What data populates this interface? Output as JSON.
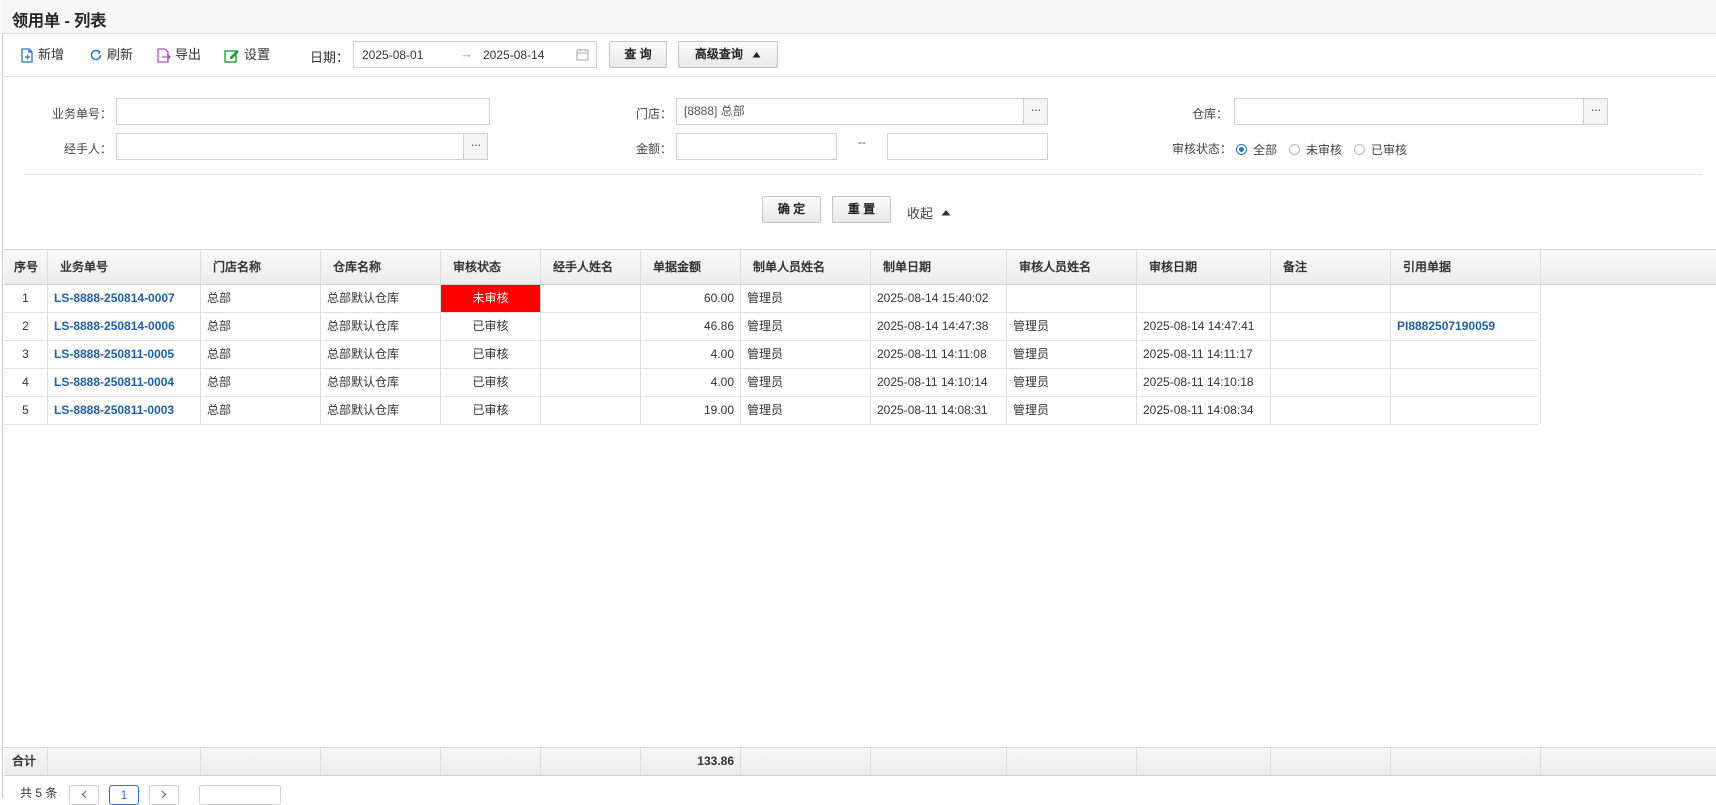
{
  "window": {
    "title": "领用单 - 列表"
  },
  "toolbar": {
    "add": "新增",
    "refresh": "刷新",
    "export": "导出",
    "settings": "设置",
    "date_label": "日期：",
    "date_from": "2025-08-01",
    "date_arrow": "→",
    "date_to": "2025-08-14",
    "query": "查 询",
    "advanced_query": "高级查询"
  },
  "filters": {
    "doc_no_label": "业务单号：",
    "doc_no_value": "",
    "store_label": "门店：",
    "store_value": "[8888] 总部",
    "warehouse_label": "仓库：",
    "warehouse_value": "",
    "handler_label": "经手人：",
    "handler_value": "",
    "amount_label": "金额：",
    "amount_from": "",
    "amount_sep": "--",
    "amount_to": "",
    "status_label": "审核状态：",
    "status_options": [
      "全部",
      "未审核",
      "已审核"
    ],
    "status_selected": "全部",
    "ok": "确 定",
    "reset": "重 置",
    "collapse": "收起",
    "more_glyph": "···"
  },
  "table": {
    "columns": [
      "序号",
      "业务单号",
      "门店名称",
      "仓库名称",
      "审核状态",
      "经手人姓名",
      "单据金额",
      "制单人员姓名",
      "制单日期",
      "审核人员姓名",
      "审核日期",
      "备注",
      "引用单据"
    ],
    "rows": [
      {
        "idx": "1",
        "doc_no": "LS-8888-250814-0007",
        "store": "总部",
        "warehouse": "总部默认仓库",
        "status": "未审核",
        "handler": "",
        "amount": "60.00",
        "creator": "管理员",
        "created": "2025-08-14 15:40:02",
        "reviewer": "",
        "reviewed": "",
        "remark": "",
        "ref": ""
      },
      {
        "idx": "2",
        "doc_no": "LS-8888-250814-0006",
        "store": "总部",
        "warehouse": "总部默认仓库",
        "status": "已审核",
        "handler": "",
        "amount": "46.86",
        "creator": "管理员",
        "created": "2025-08-14 14:47:38",
        "reviewer": "管理员",
        "reviewed": "2025-08-14 14:47:41",
        "remark": "",
        "ref": "PI8882507190059"
      },
      {
        "idx": "3",
        "doc_no": "LS-8888-250811-0005",
        "store": "总部",
        "warehouse": "总部默认仓库",
        "status": "已审核",
        "handler": "",
        "amount": "4.00",
        "creator": "管理员",
        "created": "2025-08-11 14:11:08",
        "reviewer": "管理员",
        "reviewed": "2025-08-11 14:11:17",
        "remark": "",
        "ref": ""
      },
      {
        "idx": "4",
        "doc_no": "LS-8888-250811-0004",
        "store": "总部",
        "warehouse": "总部默认仓库",
        "status": "已审核",
        "handler": "",
        "amount": "4.00",
        "creator": "管理员",
        "created": "2025-08-11 14:10:14",
        "reviewer": "管理员",
        "reviewed": "2025-08-11 14:10:18",
        "remark": "",
        "ref": ""
      },
      {
        "idx": "5",
        "doc_no": "LS-8888-250811-0003",
        "store": "总部",
        "warehouse": "总部默认仓库",
        "status": "已审核",
        "handler": "",
        "amount": "19.00",
        "creator": "管理员",
        "created": "2025-08-11 14:08:31",
        "reviewer": "管理员",
        "reviewed": "2025-08-11 14:08:34",
        "remark": "",
        "ref": ""
      }
    ],
    "footer_label": "合计",
    "footer_amount": "133.86"
  },
  "pager": {
    "total_text": "共 5 条",
    "current_page": "1"
  },
  "colors": {
    "unreviewed_bg": "#ff0000",
    "link": "#1f5fa6",
    "radio_accent": "#2a73c9"
  }
}
